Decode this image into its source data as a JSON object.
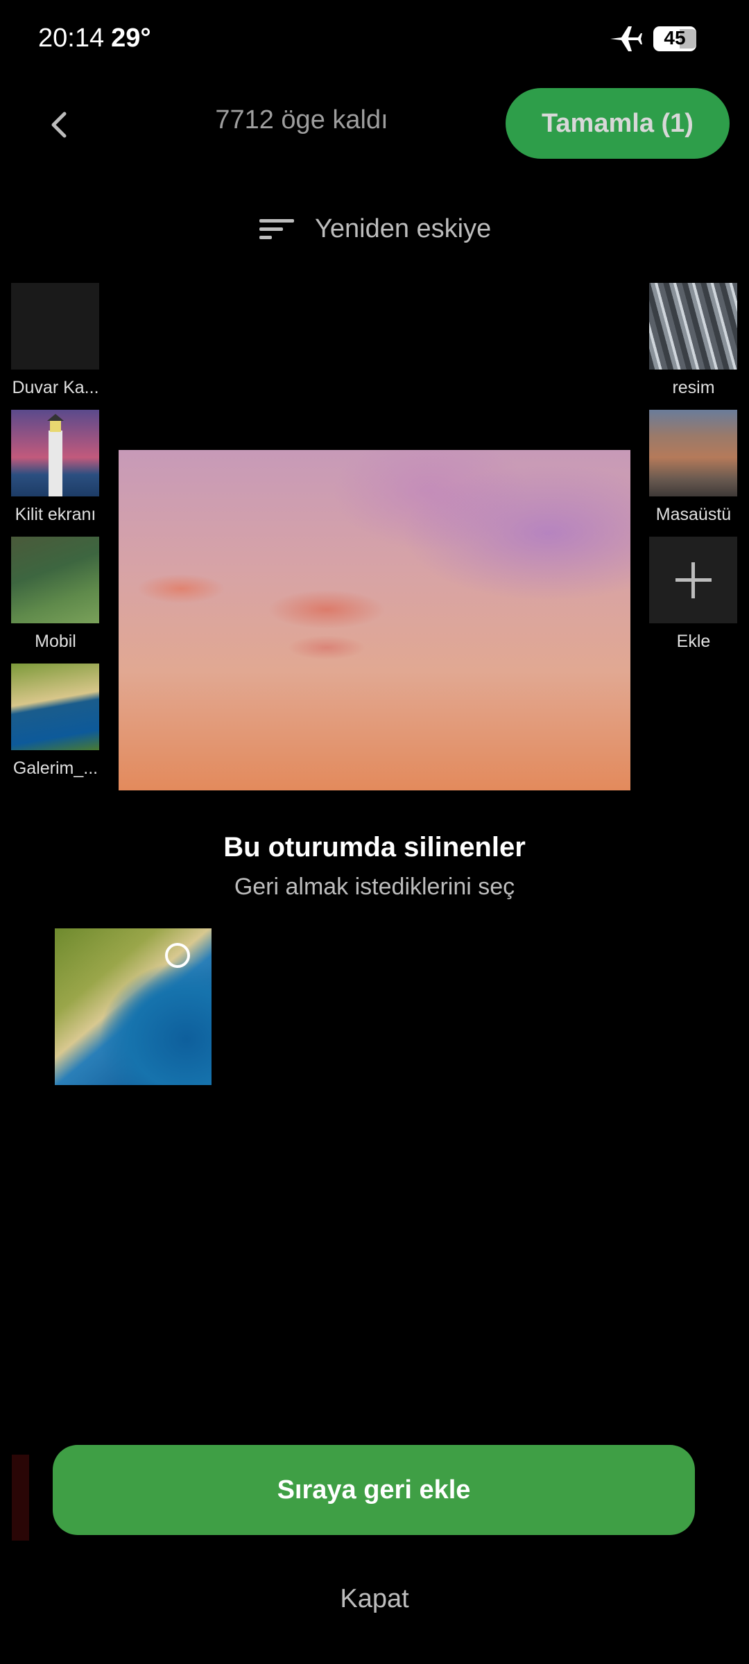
{
  "status_bar": {
    "time": "20:14",
    "temperature": "29°",
    "battery": "45",
    "airplane_icon": "airplane-icon"
  },
  "header": {
    "remaining": "7712 öge kaldı",
    "done_button": "Tamamla (1)"
  },
  "sort": {
    "label": "Yeniden eskiye"
  },
  "albums_left": [
    {
      "label": "Duvar Ka..."
    },
    {
      "label": "Kilit ekranı"
    },
    {
      "label": "Mobil"
    },
    {
      "label": "Galerim_..."
    }
  ],
  "albums_right": [
    {
      "label": "resim"
    },
    {
      "label": "Masaüstü"
    },
    {
      "label": "Ekle"
    }
  ],
  "deleted_section": {
    "title": "Bu oturumda silinenler",
    "subtitle": "Geri almak istediklerini seç"
  },
  "actions": {
    "restore": "Sıraya geri ekle",
    "close": "Kapat"
  },
  "colors": {
    "accent_green": "#3f9f45",
    "done_green": "#2e9e4a",
    "background": "#000000"
  }
}
